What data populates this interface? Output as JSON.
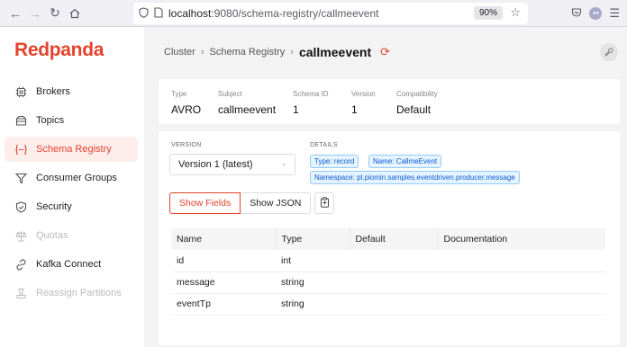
{
  "browser": {
    "url_host": "localhost",
    "url_rest": ":9080/schema-registry/callmeevent",
    "zoom": "90%"
  },
  "sidebar": {
    "logo": "Redpanda",
    "items": [
      {
        "label": "Brokers",
        "icon": "server-icon",
        "state": "normal"
      },
      {
        "label": "Topics",
        "icon": "folder-icon",
        "state": "normal"
      },
      {
        "label": "Schema Registry",
        "icon": "schema-icon",
        "state": "active"
      },
      {
        "label": "Consumer Groups",
        "icon": "filter-icon",
        "state": "normal"
      },
      {
        "label": "Security",
        "icon": "shield-icon",
        "state": "normal"
      },
      {
        "label": "Quotas",
        "icon": "scale-icon",
        "state": "disabled"
      },
      {
        "label": "Kafka Connect",
        "icon": "link-icon",
        "state": "normal"
      },
      {
        "label": "Reassign Partitions",
        "icon": "reassign-icon",
        "state": "disabled"
      }
    ]
  },
  "breadcrumb": {
    "cluster": "Cluster",
    "section": "Schema Registry",
    "current": "callmeevent"
  },
  "info": {
    "type_label": "Type",
    "type_value": "AVRO",
    "subject_label": "Subject",
    "subject_value": "callmeevent",
    "schema_id_label": "Schema ID",
    "schema_id_value": "1",
    "version_label": "Version",
    "version_value": "1",
    "compat_label": "Compatibility",
    "compat_value": "Default"
  },
  "details": {
    "version_label": "VERSION",
    "version_selected": "Version 1 (latest)",
    "details_label": "DETAILS",
    "tags": [
      "Type: record",
      "Name: CallmeEvent",
      "Namespace: pl.piomin.samples.eventdriven.producer.message"
    ]
  },
  "buttons": {
    "show_fields": "Show Fields",
    "show_json": "Show JSON"
  },
  "table": {
    "headers": [
      "Name",
      "Type",
      "Default",
      "Documentation"
    ],
    "rows": [
      [
        "id",
        "int",
        "",
        ""
      ],
      [
        "message",
        "string",
        "",
        ""
      ],
      [
        "eventTp",
        "string",
        "",
        ""
      ]
    ]
  },
  "colors": {
    "brand": "#e3432c",
    "tag_bg": "#e6f4ff",
    "tag_text": "#0958d9"
  }
}
